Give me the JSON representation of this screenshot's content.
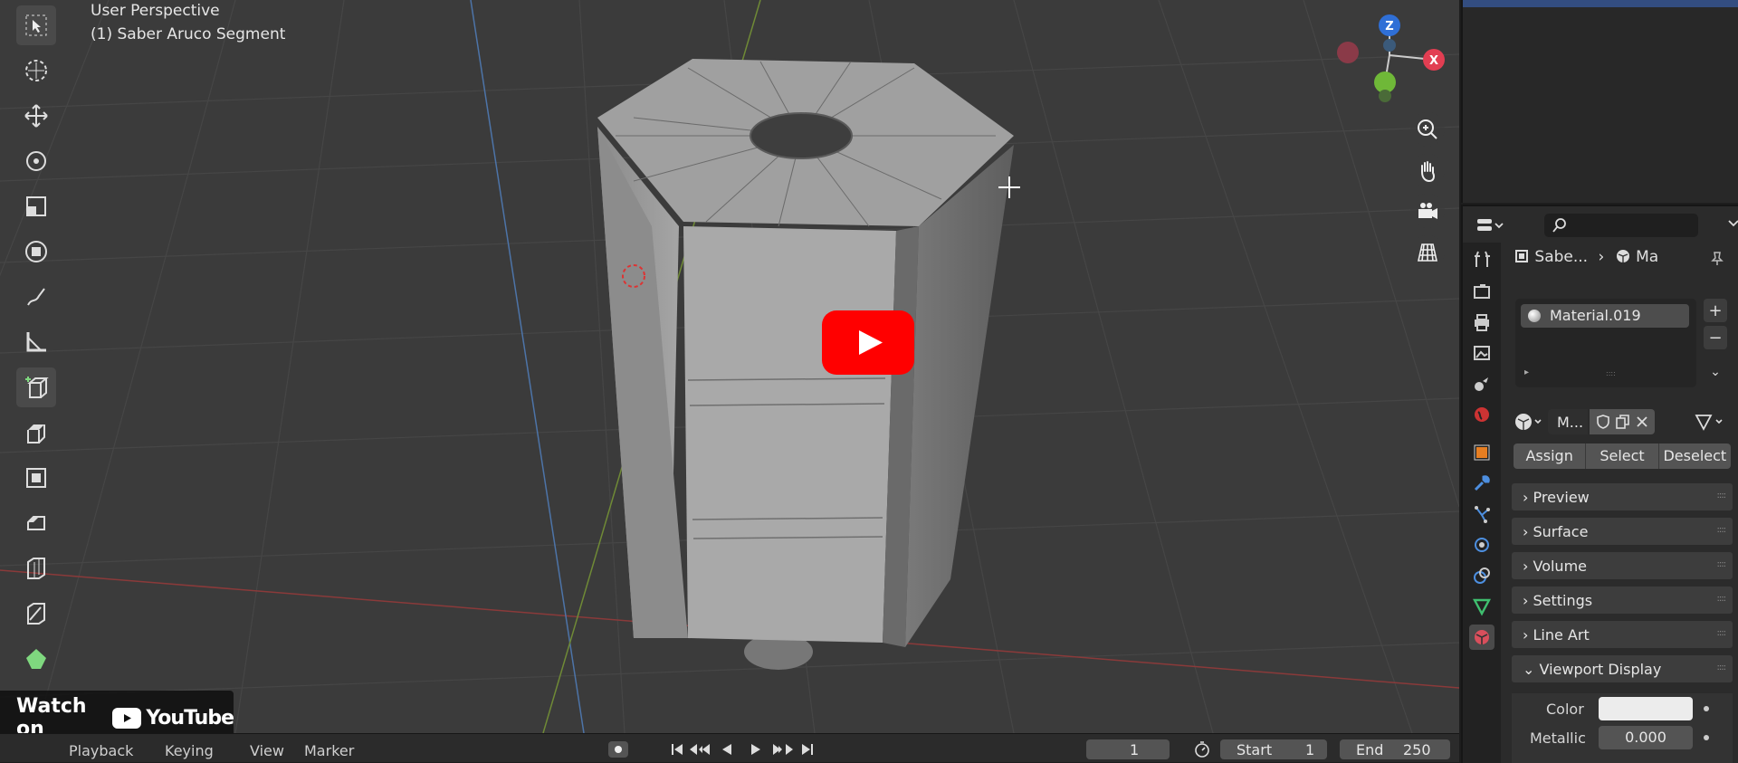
{
  "viewport": {
    "mode": "User Perspective",
    "object": "(1) Saber Aruco Segment"
  },
  "tools": [
    {
      "name": "select-box-icon",
      "active": true
    },
    {
      "name": "cursor-icon",
      "active": false
    },
    {
      "name": "move-icon",
      "active": false
    },
    {
      "name": "rotate-icon",
      "active": false
    },
    {
      "name": "scale-icon",
      "active": false
    },
    {
      "name": "transform-icon",
      "active": false
    },
    {
      "name": "annotate-icon",
      "active": false
    },
    {
      "name": "measure-icon",
      "active": false
    },
    {
      "name": "add-cube-icon",
      "active": false
    },
    {
      "name": "extrude-icon",
      "active": false
    },
    {
      "name": "inset-icon",
      "active": false
    },
    {
      "name": "bevel-icon",
      "active": false
    },
    {
      "name": "loop-cut-icon",
      "active": false
    },
    {
      "name": "knife-icon",
      "active": false
    },
    {
      "name": "poly-build-icon",
      "active": false
    }
  ],
  "gizmo": {
    "z": "Z",
    "x": "X"
  },
  "overlay": {
    "watch_on": "Watch on",
    "youtube": "YouTube"
  },
  "timeline": {
    "playback": "Playback",
    "keying": "Keying",
    "view": "View",
    "marker": "Marker",
    "current_frame": "1",
    "start_label": "Start",
    "start_value": "1",
    "end_label": "End",
    "end_value": "250"
  },
  "properties": {
    "breadcrumb_object": "Sabe...",
    "breadcrumb_material": "Ma",
    "material_slot": "Material.019",
    "material_name": "M...",
    "assign": "Assign",
    "select": "Select",
    "deselect": "Deselect",
    "panels": [
      "Preview",
      "Surface",
      "Volume",
      "Settings",
      "Line Art"
    ],
    "viewport_display": "Viewport Display",
    "color_label": "Color",
    "metallic_label": "Metallic",
    "metallic_value": "0.000",
    "color_value": "#ececec"
  }
}
